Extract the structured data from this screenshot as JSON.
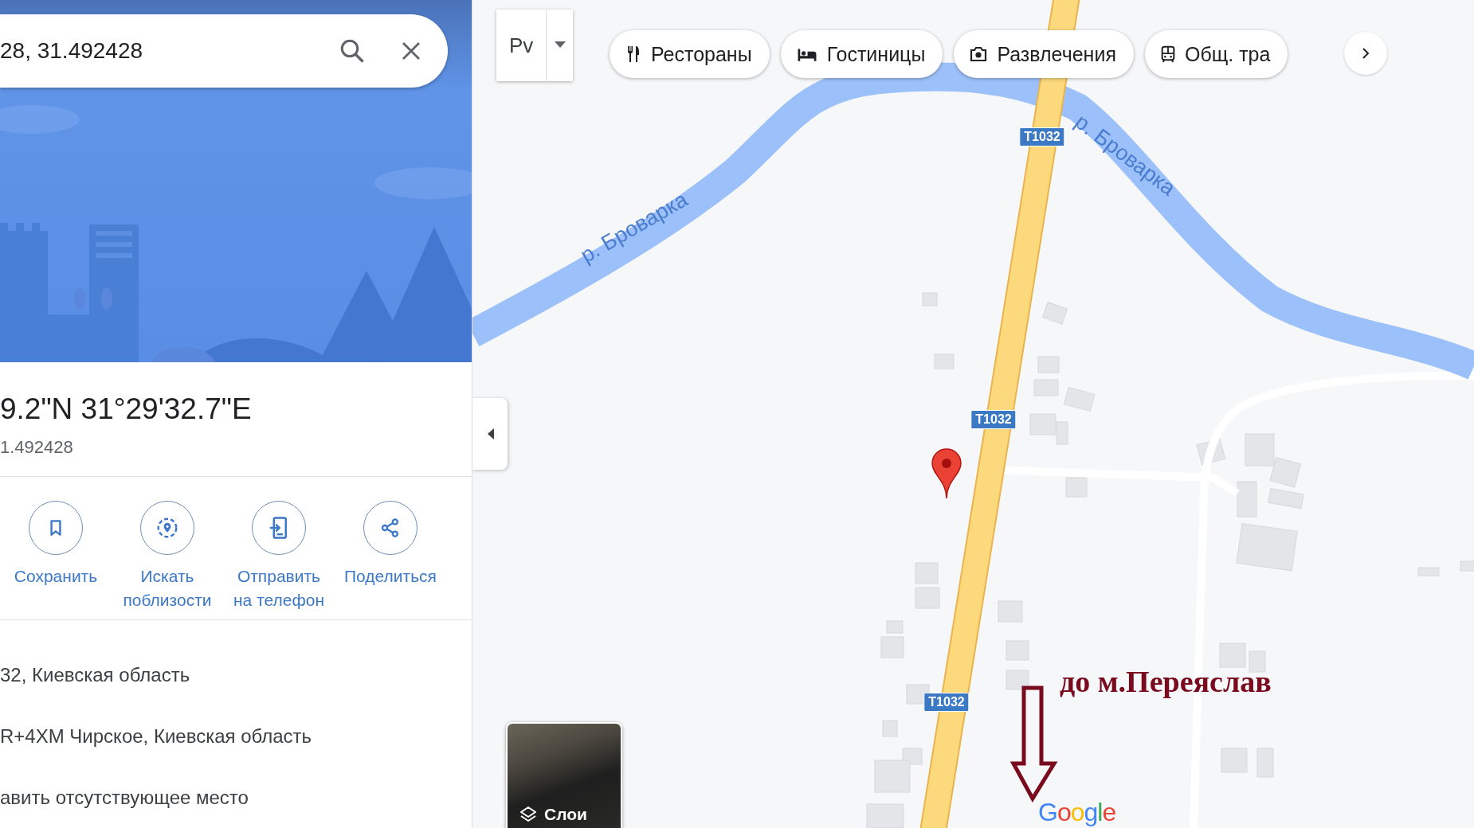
{
  "search": {
    "value": "28, 31.492428"
  },
  "place": {
    "title": "9.2\"N 31°29'32.7\"E",
    "subtitle": "1.492428"
  },
  "actions": [
    {
      "label": "Сохранить",
      "kind": "save"
    },
    {
      "label": "Искать поблизости",
      "kind": "nearby"
    },
    {
      "label": "Отправить на телефон",
      "kind": "phone"
    },
    {
      "label": "Поделиться",
      "kind": "share"
    }
  ],
  "details": [
    "32, Киевская область",
    "R+4XM Чирское, Киевская область",
    "авить отсутствующее место"
  ],
  "map": {
    "language_button": "Рv",
    "chips": [
      {
        "label": "Рестораны",
        "kind": "restaurant"
      },
      {
        "label": "Гостиницы",
        "kind": "hotel"
      },
      {
        "label": "Развлечения",
        "kind": "camera"
      },
      {
        "label": "Общ. тра",
        "kind": "transit"
      }
    ],
    "road_labels": [
      "Т1032",
      "Т1032",
      "Т1032"
    ],
    "river_labels": [
      "р. Броварка",
      "р. Броварка"
    ],
    "layers_label": "Слои",
    "annotation": "до м.Переяслав",
    "logo": "Google"
  }
}
